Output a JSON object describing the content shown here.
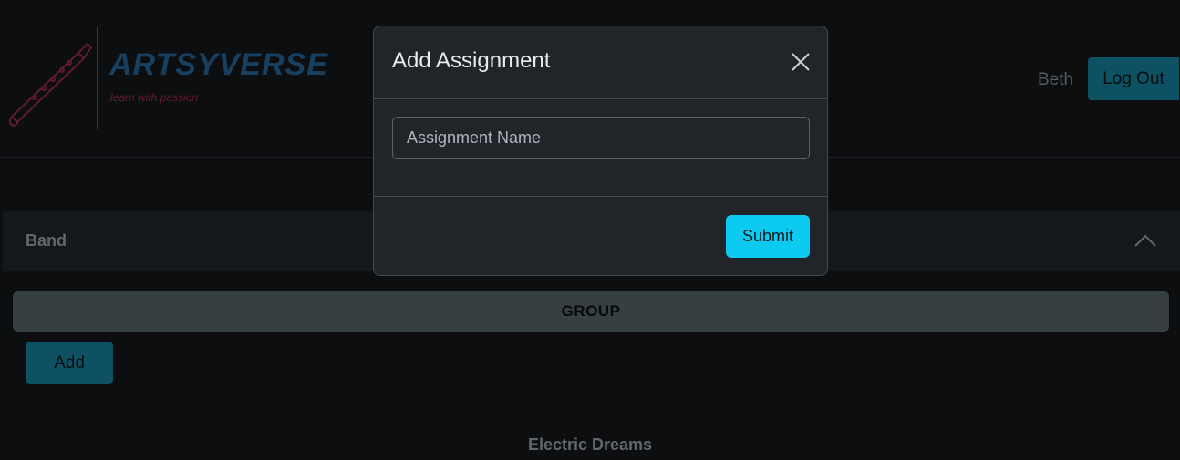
{
  "header": {
    "logo": {
      "brand": "ARTSYVERSE",
      "tagline": "learn with passion",
      "icon": "clarinet-icon"
    },
    "user_name": "Beth",
    "logout_label": "Log Out"
  },
  "section": {
    "title": "Band",
    "group_label": "GROUP",
    "add_label": "Add",
    "group_name": "Electric Dreams"
  },
  "modal": {
    "title": "Add Assignment",
    "input_placeholder": "Assignment Name",
    "submit_label": "Submit"
  },
  "colors": {
    "accent": "#0dcaf0",
    "logo_blue": "#2f7fbf",
    "logo_pink": "#c0345e"
  }
}
